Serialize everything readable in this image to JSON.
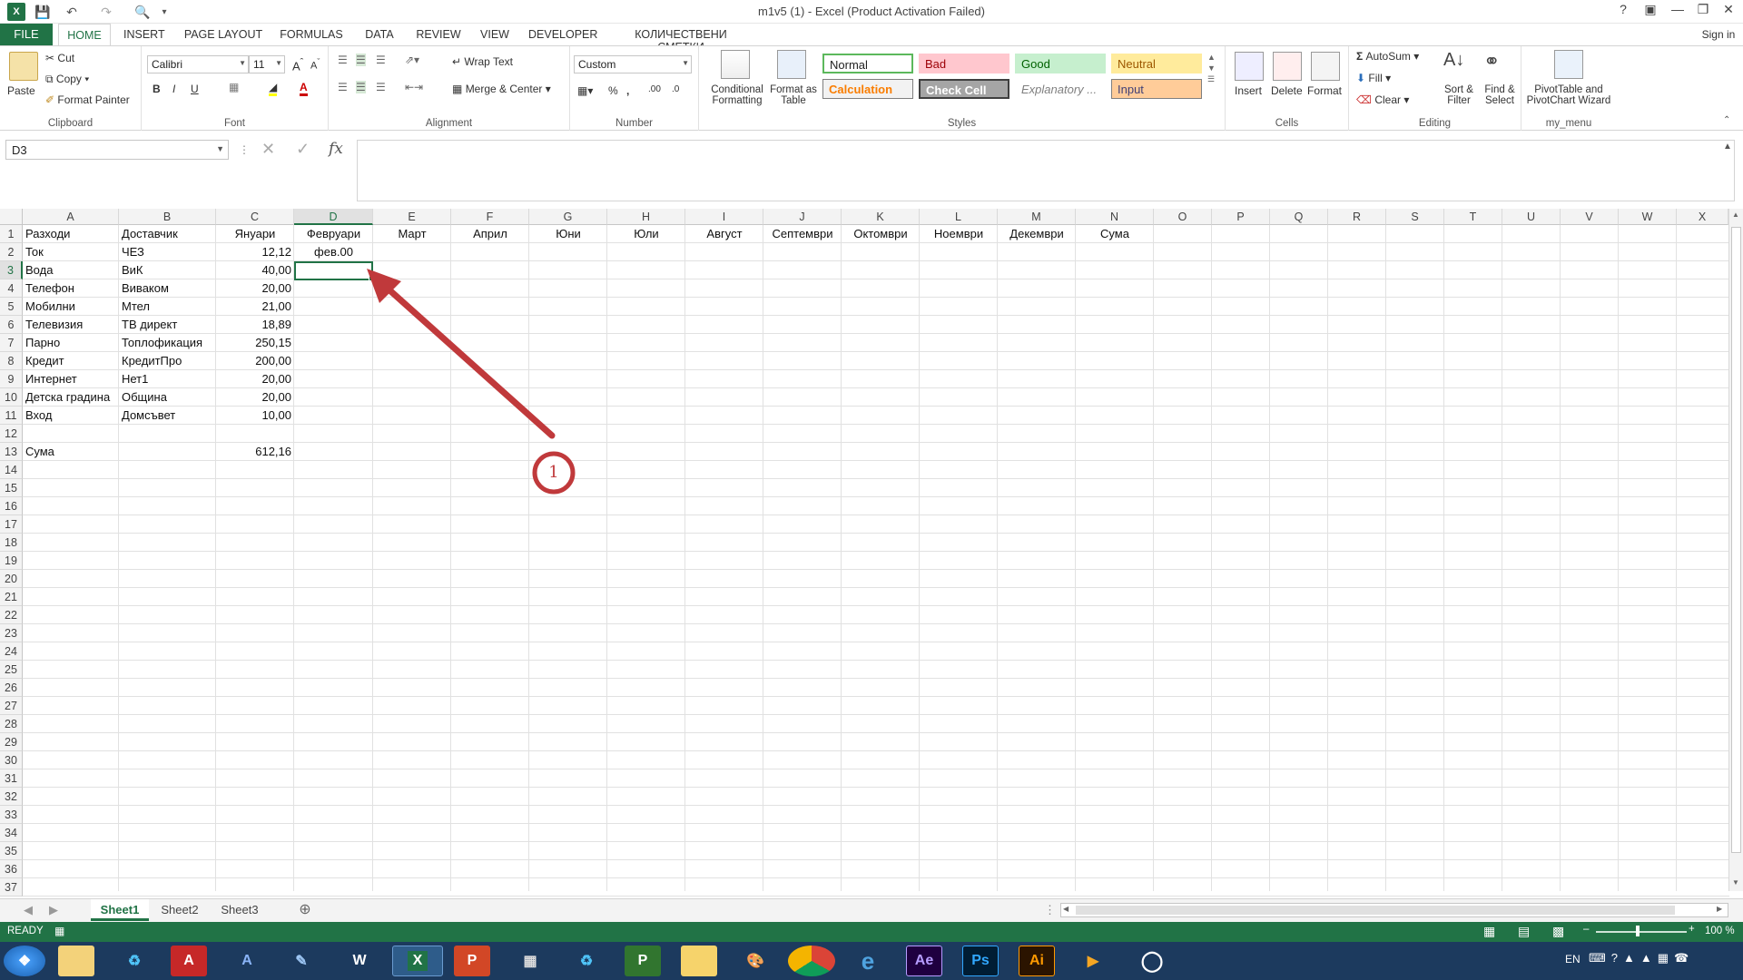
{
  "window": {
    "title": "m1v5 (1) - Excel (Product Activation Failed)",
    "help": "?",
    "sign_in": "Sign in"
  },
  "tabs": {
    "file": "FILE",
    "home": "HOME",
    "items": [
      "INSERT",
      "PAGE LAYOUT",
      "FORMULAS",
      "DATA",
      "REVIEW",
      "VIEW",
      "DEVELOPER",
      "КОЛИЧЕСТВЕНИ СМЕТКИ"
    ]
  },
  "ribbon": {
    "clipboard": {
      "paste": "Paste",
      "cut": "Cut",
      "copy": "Copy",
      "format_painter": "Format Painter",
      "label": "Clipboard"
    },
    "font": {
      "name": "Calibri",
      "size": "11",
      "label": "Font"
    },
    "alignment": {
      "wrap": "Wrap Text",
      "merge": "Merge & Center",
      "label": "Alignment"
    },
    "number": {
      "format": "Custom",
      "label": "Number"
    },
    "styles": {
      "conditional": "Conditional Formatting",
      "format_table": "Format as Table",
      "normal": "Normal",
      "bad": "Bad",
      "good": "Good",
      "neutral": "Neutral",
      "calculation": "Calculation",
      "check_cell": "Check Cell",
      "explanatory": "Explanatory ...",
      "input": "Input",
      "label": "Styles"
    },
    "cells": {
      "insert": "Insert",
      "delete": "Delete",
      "format": "Format",
      "label": "Cells"
    },
    "editing": {
      "autosum": "AutoSum",
      "fill": "Fill",
      "clear": "Clear",
      "sort": "Sort & Filter",
      "find": "Find & Select",
      "label": "Editing"
    },
    "my_menu": {
      "pivot": "PivotTable and PivotChart Wizard",
      "label": "my_menu"
    }
  },
  "formula_bar": {
    "name_box": "D3",
    "content": ""
  },
  "columns": [
    "A",
    "B",
    "C",
    "D",
    "E",
    "F",
    "G",
    "H",
    "I",
    "J",
    "K",
    "L",
    "M",
    "N",
    "O",
    "P",
    "Q",
    "R",
    "S",
    "T",
    "U",
    "V",
    "W",
    "X"
  ],
  "rows": [
    [
      "Разходи",
      "Доставчик",
      "Януари",
      "Февруари",
      "Март",
      "Април",
      "Юни",
      "Юли",
      "Август",
      "Септември",
      "Октомври",
      "Ноември",
      "Декември",
      "Сума"
    ],
    [
      "Ток",
      "ЧЕЗ",
      "12,12",
      "фев.00"
    ],
    [
      "Вода",
      "ВиК",
      "40,00"
    ],
    [
      "Телефон",
      "Виваком",
      "20,00"
    ],
    [
      "Мобилни",
      "Мтел",
      "21,00"
    ],
    [
      "Телевизия",
      "ТВ директ",
      "18,89"
    ],
    [
      "Парно",
      "Топлофикация",
      "250,15"
    ],
    [
      "Кредит",
      "КредитПро",
      "200,00"
    ],
    [
      "Интернет",
      "Нет1",
      "20,00"
    ],
    [
      "Детска градина",
      "Община",
      "20,00"
    ],
    [
      "Вход",
      "Домсъвет",
      "10,00"
    ],
    [],
    [
      "Сума",
      "",
      "612,16"
    ]
  ],
  "row_numbers": [
    "1",
    "2",
    "3",
    "4",
    "5",
    "6",
    "7",
    "8",
    "9",
    "10",
    "11",
    "12",
    "13",
    "14",
    "15",
    "16",
    "17",
    "18",
    "19",
    "20",
    "21",
    "22",
    "23",
    "24",
    "25",
    "26",
    "27",
    "28",
    "29",
    "30",
    "31",
    "32",
    "33",
    "34",
    "35",
    "36",
    "37"
  ],
  "annotation": {
    "label": "1",
    "color": "#c0393b"
  },
  "sheets": [
    "Sheet1",
    "Sheet2",
    "Sheet3"
  ],
  "active_sheet": "Sheet1",
  "status": {
    "mode": "READY",
    "zoom": "100 %"
  },
  "taskbar": {
    "lang": "EN",
    "apps": [
      "Ae",
      "Ps",
      "Ai",
      "P",
      "W"
    ]
  },
  "colors": {
    "excel_green": "#217346",
    "taskbar": "#1c3a5e"
  }
}
